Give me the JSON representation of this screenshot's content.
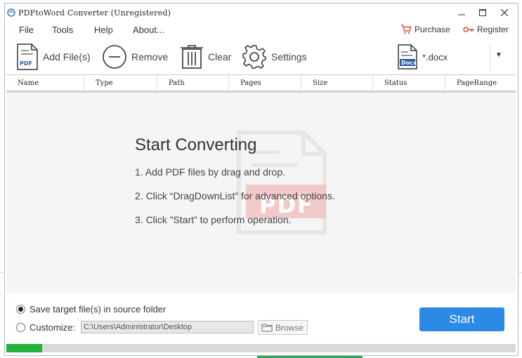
{
  "window": {
    "title": "PDFtoWord Converter (Unregistered)"
  },
  "window_controls": {
    "minimize": "—",
    "maximize": "☐",
    "close": "✕"
  },
  "menu": {
    "items": [
      "File",
      "Tools",
      "Help",
      "About..."
    ]
  },
  "topright": {
    "purchase": "Purchase",
    "register": "Register"
  },
  "toolbar": {
    "add_files": "Add File(s)",
    "remove": "Remove",
    "clear": "Clear",
    "settings": "Settings"
  },
  "format": {
    "label": "*.docx",
    "icon_text": "Docx"
  },
  "table": {
    "columns": [
      "Name",
      "Type",
      "Path",
      "Pages",
      "Size",
      "Status",
      "PageRange"
    ]
  },
  "hints": {
    "title": "Start Converting",
    "step1": "1. Add PDF files by drag and drop.",
    "step2": "2. Click “DragDownList” for advanced options.",
    "step3": "3. Click ”Start” to perform operation."
  },
  "watermark_text": "PDF",
  "output": {
    "source_label": "Save target file(s) in source folder",
    "customize_label": "Customize:",
    "path_value": "C:\\Users\\Administrator\\Desktop",
    "browse": "Browse",
    "selected": "source"
  },
  "start": "Start",
  "progress": {
    "value": 0.07
  },
  "colors": {
    "accent": "#2b8ae6",
    "progress": "#21b33c",
    "icon_red": "#e0463c"
  }
}
